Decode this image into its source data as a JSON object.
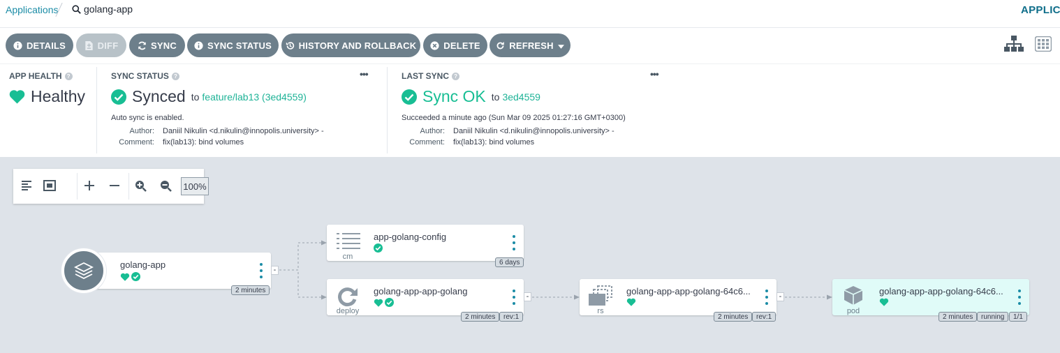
{
  "breadcrumb": {
    "apps_label": "Applications",
    "current": "golang-app",
    "right_label": "APPLICA"
  },
  "toolbar": {
    "details": "DETAILS",
    "diff": "DIFF",
    "sync": "SYNC",
    "sync_status": "SYNC STATUS",
    "history": "HISTORY AND ROLLBACK",
    "delete": "DELETE",
    "refresh": "REFRESH"
  },
  "health": {
    "label": "APP HEALTH",
    "value": "Healthy"
  },
  "sync_status": {
    "label": "SYNC STATUS",
    "value": "Synced",
    "to": "to",
    "target": "feature/lab13 (3ed4559)",
    "auto": "Auto sync is enabled.",
    "author_key": "Author:",
    "author": "Daniil Nikulin <d.nikulin@innopolis.university> -",
    "comment_key": "Comment:",
    "comment": "fix(lab13): bind volumes",
    "more": "•••"
  },
  "last_sync": {
    "label": "LAST SYNC",
    "value": "Sync OK",
    "to": "to",
    "revision": "3ed4559",
    "time": "Succeeded a minute ago (Sun Mar 09 2025 01:27:16 GMT+0300)",
    "author_key": "Author:",
    "author": "Daniil Nikulin <d.nikulin@innopolis.university> -",
    "comment_key": "Comment:",
    "comment": "fix(lab13): bind volumes",
    "more": "•••"
  },
  "zoom": {
    "value": "100%"
  },
  "nodes": {
    "root": {
      "name": "golang-app",
      "age": "2 minutes"
    },
    "config": {
      "name": "app-golang-config",
      "kind": "cm",
      "age": "6 days"
    },
    "deploy": {
      "name": "golang-app-app-golang",
      "kind": "deploy",
      "age": "2 minutes",
      "rev": "rev:1"
    },
    "rs": {
      "name": "golang-app-app-golang-64c6...",
      "kind": "rs",
      "age": "2 minutes",
      "rev": "rev:1"
    },
    "pod": {
      "name": "golang-app-app-golang-64c6...",
      "kind": "pod",
      "age": "2 minutes",
      "status": "running",
      "ready": "1/1"
    }
  },
  "colors": {
    "accent": "#1b8ca6",
    "healthy": "#18be94",
    "button": "#6d7f8b",
    "canvas": "#dee3e9"
  }
}
